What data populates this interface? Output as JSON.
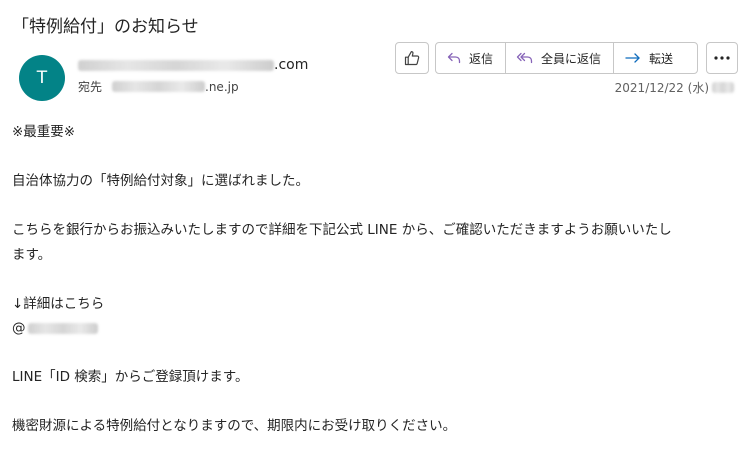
{
  "email": {
    "subject": "「特例給付」のお知らせ",
    "avatar_initial": "T",
    "sender_domain_suffix": ".com",
    "recipient_label": "宛先",
    "recipient_domain_suffix": ".ne.jp",
    "date": "2021/12/22 (水)"
  },
  "actions": {
    "like_icon": "thumbs-up-icon",
    "reply_label": "返信",
    "reply_all_label": "全員に返信",
    "forward_label": "転送",
    "more_icon": "more-options-icon"
  },
  "body": {
    "line1": "※最重要※",
    "line2": "自治体協力の「特例給付対象」に選ばれました。",
    "line3a": "こちらを銀行からお振込みいたしますので詳細を下記公式 LINE から、ご確認いただきますようお願いいたし",
    "line3b": "ます。",
    "line4": "↓詳細はこちら",
    "line5_prefix": "@",
    "line6": "LINE「ID 検索」からご登録頂けます。",
    "line7": "機密財源による特例給付となりますので、期限内にお受け取りください。"
  },
  "colors": {
    "avatar_bg": "#038387",
    "accent_purple": "#8764b8",
    "accent_blue": "#0f6cbd"
  }
}
